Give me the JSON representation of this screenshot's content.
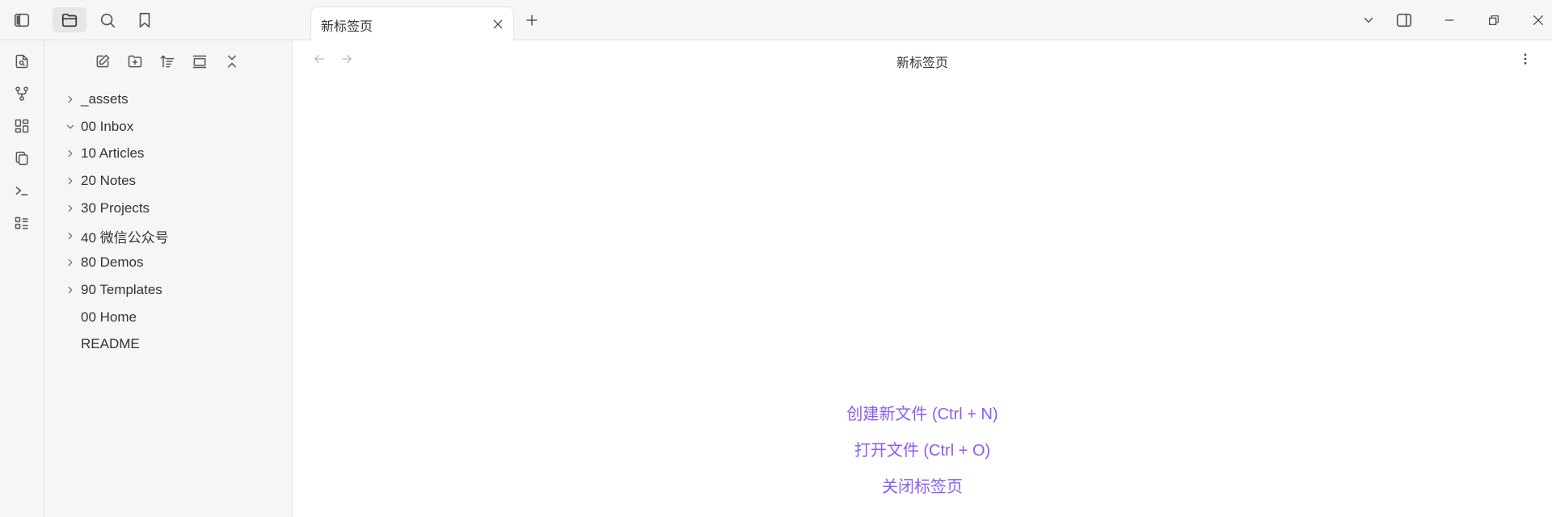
{
  "left_top": {
    "toggle_sidebar_icon": "sidebar-left-icon",
    "files_icon": "folder-icon",
    "search_icon": "search-icon",
    "bookmarks_icon": "bookmark-icon"
  },
  "ribbon": {
    "items": [
      {
        "icon": "file-search-icon"
      },
      {
        "icon": "graph-icon"
      },
      {
        "icon": "layout-dashboard-icon"
      },
      {
        "icon": "copy-icon"
      },
      {
        "icon": "terminal-icon"
      },
      {
        "icon": "list-icon"
      }
    ]
  },
  "file_nav": {
    "buttons": [
      {
        "icon": "new-note-icon"
      },
      {
        "icon": "new-folder-icon"
      },
      {
        "icon": "sort-icon"
      },
      {
        "icon": "auto-reveal-icon"
      },
      {
        "icon": "collapse-all-icon"
      }
    ]
  },
  "tree": {
    "items": [
      {
        "label": "_assets",
        "type": "folder",
        "expanded": false
      },
      {
        "label": "00 Inbox",
        "type": "folder",
        "expanded": true
      },
      {
        "label": "10 Articles",
        "type": "folder",
        "expanded": false
      },
      {
        "label": "20 Notes",
        "type": "folder",
        "expanded": false
      },
      {
        "label": "30 Projects",
        "type": "folder",
        "expanded": false
      },
      {
        "label": "40 微信公众号",
        "type": "folder",
        "expanded": false
      },
      {
        "label": "80 Demos",
        "type": "folder",
        "expanded": false
      },
      {
        "label": "90 Templates",
        "type": "folder",
        "expanded": false
      },
      {
        "label": "00 Home",
        "type": "file"
      },
      {
        "label": "README",
        "type": "file"
      }
    ]
  },
  "tabs": [
    {
      "title": "新标签页",
      "active": true
    }
  ],
  "view": {
    "title": "新标签页"
  },
  "empty_state": {
    "create_label": "创建新文件 (Ctrl + N)",
    "open_label": "打开文件 (Ctrl + O)",
    "close_label": "关闭标签页"
  },
  "colors": {
    "accent": "#8a5cf5",
    "sidebar_bg": "#f6f6f6",
    "border": "#e3e3e3"
  }
}
